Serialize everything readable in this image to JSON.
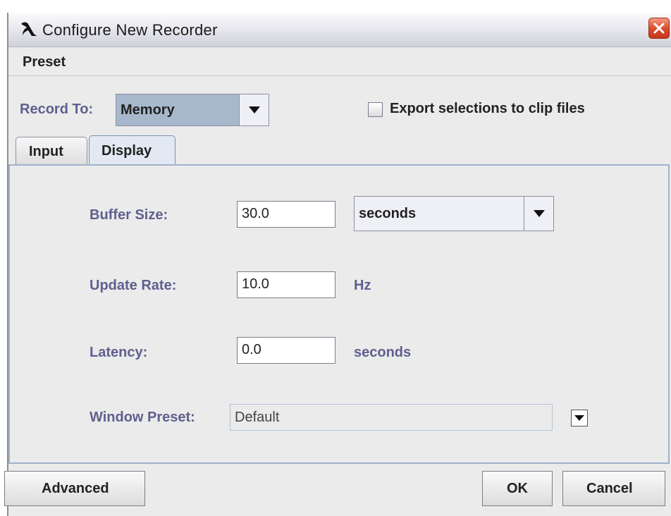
{
  "window": {
    "title": "Configure New Recorder"
  },
  "menu": {
    "preset": "Preset"
  },
  "record_to": {
    "label": "Record To:",
    "value": "Memory"
  },
  "export_checkbox": {
    "label": "Export selections to clip files",
    "checked": false
  },
  "tabs": [
    {
      "label": "Input",
      "selected": false
    },
    {
      "label": "Display",
      "selected": true
    }
  ],
  "display": {
    "buffer_size": {
      "label": "Buffer Size:",
      "value": "30.0",
      "unit": "seconds"
    },
    "update_rate": {
      "label": "Update Rate:",
      "value": "10.0",
      "unit": "Hz"
    },
    "latency": {
      "label": "Latency:",
      "value": "0.0",
      "unit": "seconds"
    },
    "window_preset": {
      "label": "Window Preset:",
      "value": "Default"
    }
  },
  "buttons": {
    "advanced": "Advanced",
    "ok": "OK",
    "cancel": "Cancel"
  },
  "colors": {
    "label_blue": "#5f5f8f",
    "panel_border": "#9fb2cc",
    "close_red": "#d84a2a"
  }
}
